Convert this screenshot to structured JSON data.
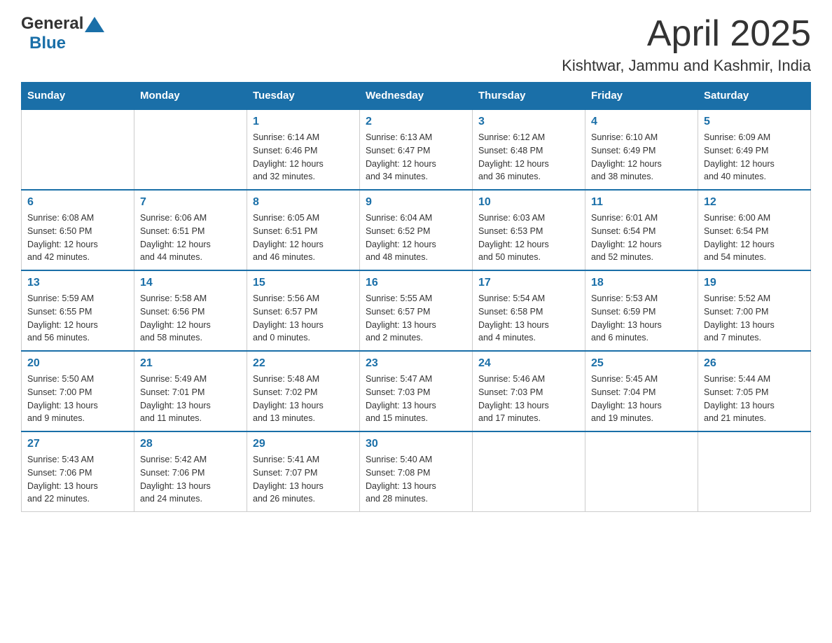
{
  "header": {
    "logo_general": "General",
    "logo_blue": "Blue",
    "title": "April 2025",
    "subtitle": "Kishtwar, Jammu and Kashmir, India"
  },
  "calendar": {
    "days_of_week": [
      "Sunday",
      "Monday",
      "Tuesday",
      "Wednesday",
      "Thursday",
      "Friday",
      "Saturday"
    ],
    "weeks": [
      [
        {
          "day": "",
          "info": ""
        },
        {
          "day": "",
          "info": ""
        },
        {
          "day": "1",
          "info": "Sunrise: 6:14 AM\nSunset: 6:46 PM\nDaylight: 12 hours\nand 32 minutes."
        },
        {
          "day": "2",
          "info": "Sunrise: 6:13 AM\nSunset: 6:47 PM\nDaylight: 12 hours\nand 34 minutes."
        },
        {
          "day": "3",
          "info": "Sunrise: 6:12 AM\nSunset: 6:48 PM\nDaylight: 12 hours\nand 36 minutes."
        },
        {
          "day": "4",
          "info": "Sunrise: 6:10 AM\nSunset: 6:49 PM\nDaylight: 12 hours\nand 38 minutes."
        },
        {
          "day": "5",
          "info": "Sunrise: 6:09 AM\nSunset: 6:49 PM\nDaylight: 12 hours\nand 40 minutes."
        }
      ],
      [
        {
          "day": "6",
          "info": "Sunrise: 6:08 AM\nSunset: 6:50 PM\nDaylight: 12 hours\nand 42 minutes."
        },
        {
          "day": "7",
          "info": "Sunrise: 6:06 AM\nSunset: 6:51 PM\nDaylight: 12 hours\nand 44 minutes."
        },
        {
          "day": "8",
          "info": "Sunrise: 6:05 AM\nSunset: 6:51 PM\nDaylight: 12 hours\nand 46 minutes."
        },
        {
          "day": "9",
          "info": "Sunrise: 6:04 AM\nSunset: 6:52 PM\nDaylight: 12 hours\nand 48 minutes."
        },
        {
          "day": "10",
          "info": "Sunrise: 6:03 AM\nSunset: 6:53 PM\nDaylight: 12 hours\nand 50 minutes."
        },
        {
          "day": "11",
          "info": "Sunrise: 6:01 AM\nSunset: 6:54 PM\nDaylight: 12 hours\nand 52 minutes."
        },
        {
          "day": "12",
          "info": "Sunrise: 6:00 AM\nSunset: 6:54 PM\nDaylight: 12 hours\nand 54 minutes."
        }
      ],
      [
        {
          "day": "13",
          "info": "Sunrise: 5:59 AM\nSunset: 6:55 PM\nDaylight: 12 hours\nand 56 minutes."
        },
        {
          "day": "14",
          "info": "Sunrise: 5:58 AM\nSunset: 6:56 PM\nDaylight: 12 hours\nand 58 minutes."
        },
        {
          "day": "15",
          "info": "Sunrise: 5:56 AM\nSunset: 6:57 PM\nDaylight: 13 hours\nand 0 minutes."
        },
        {
          "day": "16",
          "info": "Sunrise: 5:55 AM\nSunset: 6:57 PM\nDaylight: 13 hours\nand 2 minutes."
        },
        {
          "day": "17",
          "info": "Sunrise: 5:54 AM\nSunset: 6:58 PM\nDaylight: 13 hours\nand 4 minutes."
        },
        {
          "day": "18",
          "info": "Sunrise: 5:53 AM\nSunset: 6:59 PM\nDaylight: 13 hours\nand 6 minutes."
        },
        {
          "day": "19",
          "info": "Sunrise: 5:52 AM\nSunset: 7:00 PM\nDaylight: 13 hours\nand 7 minutes."
        }
      ],
      [
        {
          "day": "20",
          "info": "Sunrise: 5:50 AM\nSunset: 7:00 PM\nDaylight: 13 hours\nand 9 minutes."
        },
        {
          "day": "21",
          "info": "Sunrise: 5:49 AM\nSunset: 7:01 PM\nDaylight: 13 hours\nand 11 minutes."
        },
        {
          "day": "22",
          "info": "Sunrise: 5:48 AM\nSunset: 7:02 PM\nDaylight: 13 hours\nand 13 minutes."
        },
        {
          "day": "23",
          "info": "Sunrise: 5:47 AM\nSunset: 7:03 PM\nDaylight: 13 hours\nand 15 minutes."
        },
        {
          "day": "24",
          "info": "Sunrise: 5:46 AM\nSunset: 7:03 PM\nDaylight: 13 hours\nand 17 minutes."
        },
        {
          "day": "25",
          "info": "Sunrise: 5:45 AM\nSunset: 7:04 PM\nDaylight: 13 hours\nand 19 minutes."
        },
        {
          "day": "26",
          "info": "Sunrise: 5:44 AM\nSunset: 7:05 PM\nDaylight: 13 hours\nand 21 minutes."
        }
      ],
      [
        {
          "day": "27",
          "info": "Sunrise: 5:43 AM\nSunset: 7:06 PM\nDaylight: 13 hours\nand 22 minutes."
        },
        {
          "day": "28",
          "info": "Sunrise: 5:42 AM\nSunset: 7:06 PM\nDaylight: 13 hours\nand 24 minutes."
        },
        {
          "day": "29",
          "info": "Sunrise: 5:41 AM\nSunset: 7:07 PM\nDaylight: 13 hours\nand 26 minutes."
        },
        {
          "day": "30",
          "info": "Sunrise: 5:40 AM\nSunset: 7:08 PM\nDaylight: 13 hours\nand 28 minutes."
        },
        {
          "day": "",
          "info": ""
        },
        {
          "day": "",
          "info": ""
        },
        {
          "day": "",
          "info": ""
        }
      ]
    ]
  }
}
